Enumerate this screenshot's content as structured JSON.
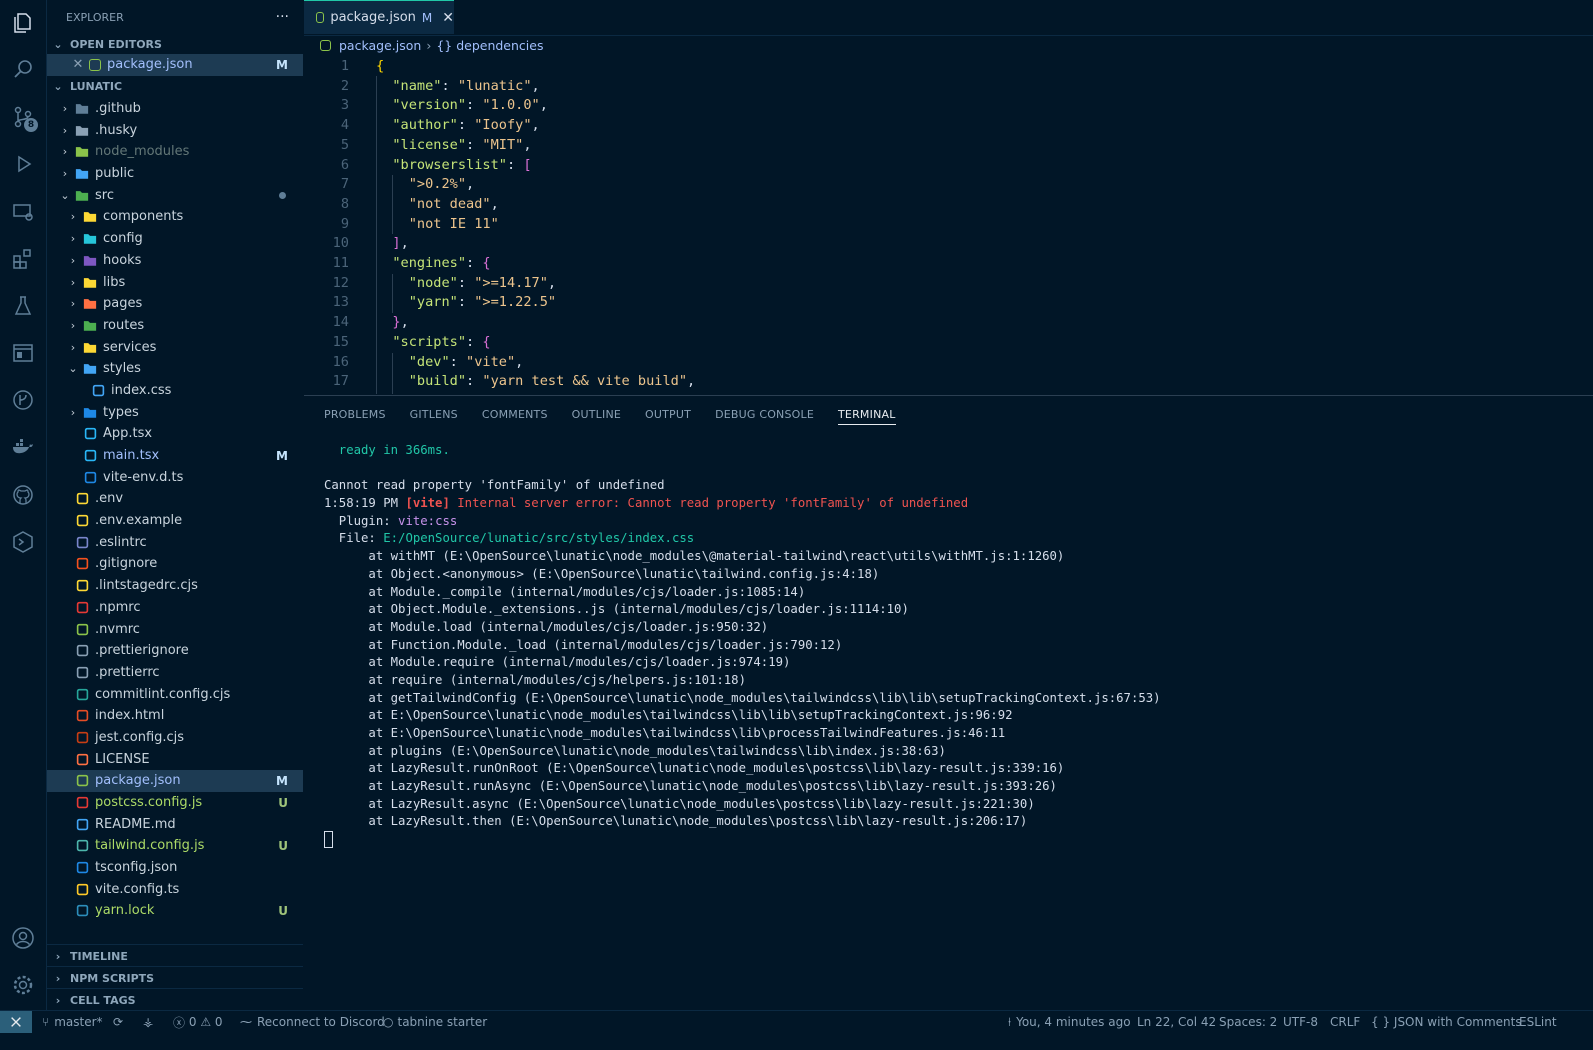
{
  "sidebar": {
    "title": "EXPLORER",
    "more": "···",
    "open_editors": {
      "label": "OPEN EDITORS",
      "items": [
        {
          "name": "package.json",
          "status": "M"
        }
      ]
    },
    "project": {
      "label": "LUNATIC",
      "items": [
        {
          "name": ".github",
          "type": "folder"
        },
        {
          "name": ".husky",
          "type": "folder"
        },
        {
          "name": "node_modules",
          "type": "folder"
        },
        {
          "name": "public",
          "type": "folder"
        },
        {
          "name": "src",
          "type": "folder-open"
        },
        {
          "name": "components",
          "type": "folder"
        },
        {
          "name": "config",
          "type": "folder"
        },
        {
          "name": "hooks",
          "type": "folder"
        },
        {
          "name": "libs",
          "type": "folder"
        },
        {
          "name": "pages",
          "type": "folder"
        },
        {
          "name": "routes",
          "type": "folder"
        },
        {
          "name": "services",
          "type": "folder"
        },
        {
          "name": "styles",
          "type": "folder-open"
        },
        {
          "name": "index.css",
          "type": "file"
        },
        {
          "name": "types",
          "type": "folder"
        },
        {
          "name": "App.tsx",
          "type": "file"
        },
        {
          "name": "main.tsx",
          "type": "file",
          "status": "M"
        },
        {
          "name": "vite-env.d.ts",
          "type": "file"
        },
        {
          "name": ".env",
          "type": "file"
        },
        {
          "name": ".env.example",
          "type": "file"
        },
        {
          "name": ".eslintrc",
          "type": "file"
        },
        {
          "name": ".gitignore",
          "type": "file"
        },
        {
          "name": ".lintstagedrc.cjs",
          "type": "file"
        },
        {
          "name": ".npmrc",
          "type": "file"
        },
        {
          "name": ".nvmrc",
          "type": "file"
        },
        {
          "name": ".prettierignore",
          "type": "file"
        },
        {
          "name": ".prettierrc",
          "type": "file"
        },
        {
          "name": "commitlint.config.cjs",
          "type": "file"
        },
        {
          "name": "index.html",
          "type": "file"
        },
        {
          "name": "jest.config.cjs",
          "type": "file"
        },
        {
          "name": "LICENSE",
          "type": "file"
        },
        {
          "name": "package.json",
          "type": "file",
          "status": "M"
        },
        {
          "name": "postcss.config.js",
          "type": "file",
          "status": "U"
        },
        {
          "name": "README.md",
          "type": "file"
        },
        {
          "name": "tailwind.config.js",
          "type": "file",
          "status": "U"
        },
        {
          "name": "tsconfig.json",
          "type": "file"
        },
        {
          "name": "vite.config.ts",
          "type": "file"
        },
        {
          "name": "yarn.lock",
          "type": "file",
          "status": "U"
        }
      ]
    },
    "sections": [
      "TIMELINE",
      "NPM SCRIPTS",
      "CELL TAGS"
    ]
  },
  "activity": {
    "scm_badge": "8"
  },
  "tab": {
    "label": "package.json",
    "modified": "M",
    "close": "✕"
  },
  "breadcrumb": {
    "file": "package.json",
    "symbol": "{} dependencies"
  },
  "code": {
    "line_numbers": [
      "1",
      "2",
      "3",
      "4",
      "5",
      "6",
      "7",
      "8",
      "9",
      "10",
      "11",
      "12",
      "13",
      "14",
      "15",
      "16",
      "17"
    ],
    "tokens": {
      "name_k": "\"name\"",
      "name_v": "\"lunatic\"",
      "version_k": "\"version\"",
      "version_v": "\"1.0.0\"",
      "author_k": "\"author\"",
      "author_v": "\"Ioofy\"",
      "license_k": "\"license\"",
      "license_v": "\"MIT\"",
      "browserslist_k": "\"browserslist\"",
      "b1": "\">0.2%\"",
      "b2": "\"not dead\"",
      "b3": "\"not IE 11\"",
      "engines_k": "\"engines\"",
      "node_k": "\"node\"",
      "node_v": "\">=14.17\"",
      "yarn_k": "\"yarn\"",
      "yarn_v": "\">=1.22.5\"",
      "scripts_k": "\"scripts\"",
      "dev_k": "\"dev\"",
      "dev_v": "\"vite\"",
      "build_k": "\"build\"",
      "build_v": "\"yarn test && vite build\""
    }
  },
  "panel": {
    "tabs": [
      "PROBLEMS",
      "GITLENS",
      "COMMENTS",
      "OUTLINE",
      "OUTPUT",
      "DEBUG CONSOLE",
      "TERMINAL"
    ],
    "terminal": {
      "ready": "  ready in 366ms.",
      "err1": "Cannot read property 'fontFamily' of undefined",
      "time": "1:58:19 PM ",
      "vite": "[vite]",
      "err2": " Internal server error: Cannot read property 'fontFamily' of undefined",
      "plugin_label": "  Plugin: ",
      "plugin": "vite:css",
      "file_label": "  File: ",
      "file": "E:/OpenSource/lunatic/src/styles/index.css",
      "stack": [
        "      at withMT (E:\\OpenSource\\lunatic\\node_modules\\@material-tailwind\\react\\utils\\withMT.js:1:1260)",
        "      at Object.<anonymous> (E:\\OpenSource\\lunatic\\tailwind.config.js:4:18)",
        "      at Module._compile (internal/modules/cjs/loader.js:1085:14)",
        "      at Object.Module._extensions..js (internal/modules/cjs/loader.js:1114:10)",
        "      at Module.load (internal/modules/cjs/loader.js:950:32)",
        "      at Function.Module._load (internal/modules/cjs/loader.js:790:12)",
        "      at Module.require (internal/modules/cjs/loader.js:974:19)",
        "      at require (internal/modules/cjs/helpers.js:101:18)",
        "      at getTailwindConfig (E:\\OpenSource\\lunatic\\node_modules\\tailwindcss\\lib\\lib\\setupTrackingContext.js:67:53)",
        "      at E:\\OpenSource\\lunatic\\node_modules\\tailwindcss\\lib\\lib\\setupTrackingContext.js:96:92",
        "      at E:\\OpenSource\\lunatic\\node_modules\\tailwindcss\\lib\\processTailwindFeatures.js:46:11",
        "      at plugins (E:\\OpenSource\\lunatic\\node_modules\\tailwindcss\\lib\\index.js:38:63)",
        "      at LazyResult.runOnRoot (E:\\OpenSource\\lunatic\\node_modules\\postcss\\lib\\lazy-result.js:339:16)",
        "      at LazyResult.runAsync (E:\\OpenSource\\lunatic\\node_modules\\postcss\\lib\\lazy-result.js:393:26)",
        "      at LazyResult.async (E:\\OpenSource\\lunatic\\node_modules\\postcss\\lib\\lazy-result.js:221:30)",
        "      at LazyResult.then (E:\\OpenSource\\lunatic\\node_modules\\postcss\\lib\\lazy-result.js:206:17)"
      ]
    }
  },
  "status": {
    "branch": "master*",
    "errors": "0",
    "warnings": "0",
    "discord": "Reconnect to Discord",
    "tabnine": "tabnine starter",
    "blame": "You, 4 minutes ago",
    "position": "Ln 22, Col 42",
    "spaces": "Spaces: 2",
    "encoding": "UTF-8",
    "eol": "CRLF",
    "language": "{ } JSON with Comments",
    "eslint": "ESLint"
  },
  "colors": {
    "background": "#011627",
    "selection": "#1d3b53",
    "accent": "#21c7a8",
    "error": "#ef5350",
    "untracked": "#addb67"
  }
}
